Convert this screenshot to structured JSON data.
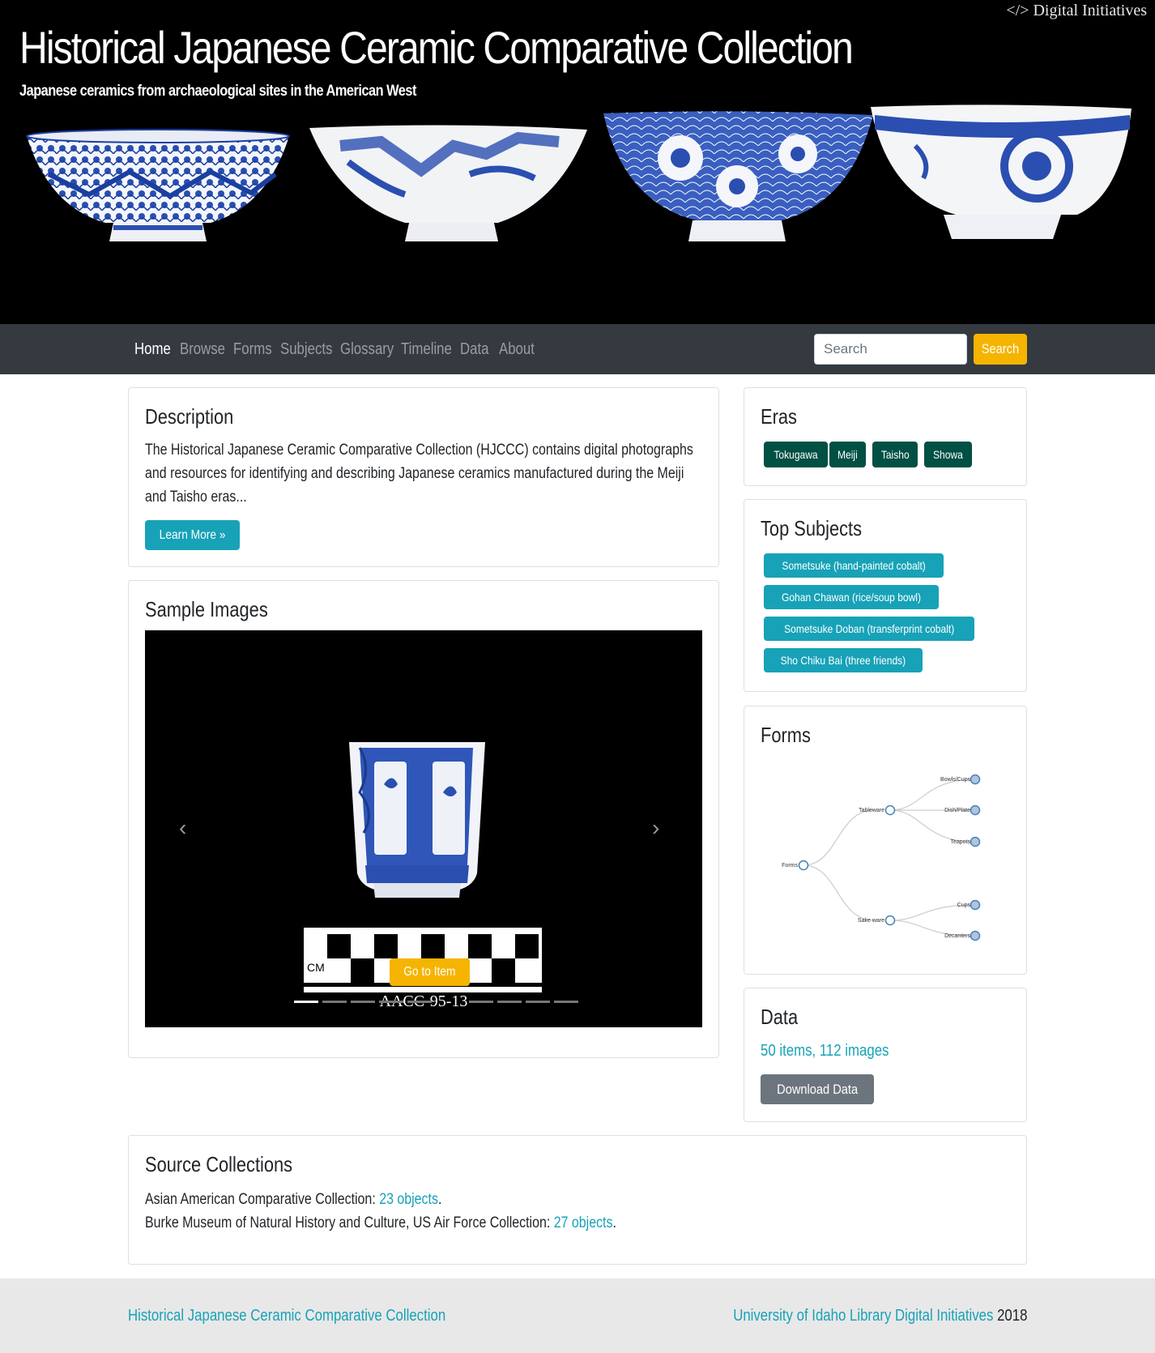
{
  "header": {
    "digital_initiatives_link": "</> Digital Initiatives",
    "title": "Historical Japanese Ceramic Comparative Collection",
    "subtitle": "Japanese ceramics from archaeological sites in the American West"
  },
  "nav": {
    "items": [
      {
        "label": "Home",
        "active": true
      },
      {
        "label": "Browse"
      },
      {
        "label": "Forms"
      },
      {
        "label": "Subjects"
      },
      {
        "label": "Glossary"
      },
      {
        "label": "Timeline"
      },
      {
        "label": "Data"
      },
      {
        "label": "About"
      }
    ],
    "search_placeholder": "Search",
    "search_button": "Search"
  },
  "description": {
    "title": "Description",
    "text": "The Historical Japanese Ceramic Comparative Collection (HJCCC) contains digital photographs and resources for identifying and describing Japanese ceramics manufactured during the Meiji and Taisho eras...",
    "learn_more": "Learn More »"
  },
  "sample_images": {
    "title": "Sample Images",
    "go_to_item": "Go to Item",
    "caption": "AACC-95-13",
    "scale_label": "CM",
    "indicator_count": 9,
    "active_indicator": 0
  },
  "eras": {
    "title": "Eras",
    "items": [
      "Tokugawa",
      "Meiji",
      "Taisho",
      "Showa"
    ]
  },
  "top_subjects": {
    "title": "Top Subjects",
    "items": [
      "Sometsuke (hand-painted cobalt)",
      "Gohan Chawan (rice/soup bowl)",
      "Sometsuke Doban (transferprint cobalt)",
      "Sho Chiku Bai (three friends)"
    ]
  },
  "forms": {
    "title": "Forms",
    "tree": {
      "root": "Forms",
      "children": [
        {
          "label": "Tableware",
          "children": [
            "Bowls/Cups",
            "Dish/Plate",
            "Teapots"
          ]
        },
        {
          "label": "Sake ware",
          "children": [
            "Cups",
            "Decanters"
          ]
        }
      ]
    }
  },
  "data_card": {
    "title": "Data",
    "summary": "50 items, 112 images",
    "download": "Download Data"
  },
  "source_collections": {
    "title": "Source Collections",
    "items": [
      {
        "name": "Asian American Comparative Collection:",
        "link": "23 objects"
      },
      {
        "name": "Burke Museum of Natural History and Culture, US Air Force Collection:",
        "link": "27 objects"
      }
    ]
  },
  "footer": {
    "left": "Historical Japanese Ceramic Comparative Collection",
    "right_link": "University of Idaho Library Digital Initiatives",
    "year": "2018"
  },
  "colors": {
    "navbar": "#343a40",
    "accent_teal": "#17a2b8",
    "era_green": "#005044",
    "warning": "#f5b400",
    "cobalt": "#1a3fa0"
  }
}
